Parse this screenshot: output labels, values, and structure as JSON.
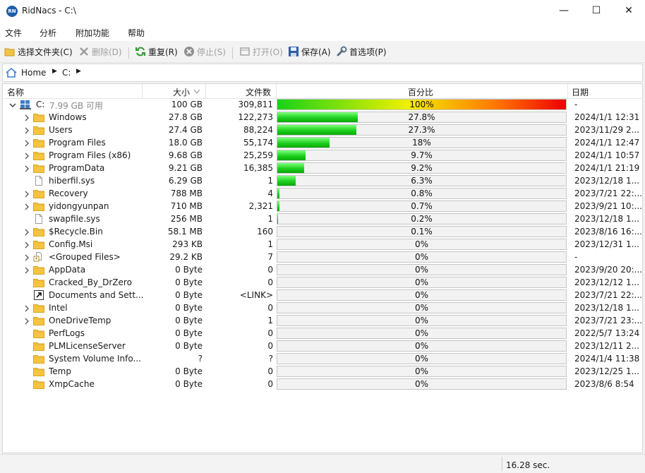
{
  "window": {
    "app_icon_text": "RN",
    "title": "RidNacs - C:\\",
    "minimize": "—",
    "maximize": "☐",
    "close": "✕"
  },
  "menu": [
    "文件",
    "分析",
    "附加功能",
    "帮助"
  ],
  "toolbar": {
    "select_folder": "选择文件夹(C)",
    "delete": "删除(D)",
    "rescan": "重复(R)",
    "stop": "停止(S)",
    "open": "打开(O)",
    "save": "保存(A)",
    "options": "首选项(P)"
  },
  "address": {
    "home": "Home",
    "drive": "C:"
  },
  "columns": {
    "name": "名称",
    "size": "大小",
    "files": "文件数",
    "percent": "百分比",
    "date": "日期"
  },
  "root": {
    "name": "C:",
    "free": "7.99 GB 可用",
    "size": "100 GB",
    "files": "309,811",
    "percent": 100,
    "percent_label": "100%",
    "date": "-"
  },
  "rows": [
    {
      "name": "Windows",
      "kind": "folder",
      "size": "27.8 GB",
      "files": "122,273",
      "percent": 27.8,
      "percent_label": "27.8%",
      "date": "2024/1/1 12:31",
      "expandable": true
    },
    {
      "name": "Users",
      "kind": "folder",
      "size": "27.4 GB",
      "files": "88,224",
      "percent": 27.3,
      "percent_label": "27.3%",
      "date": "2023/11/29 2...",
      "expandable": true
    },
    {
      "name": "Program Files",
      "kind": "folder",
      "size": "18.0 GB",
      "files": "55,174",
      "percent": 18,
      "percent_label": "18%",
      "date": "2024/1/1 12:47",
      "expandable": true
    },
    {
      "name": "Program Files (x86)",
      "kind": "folder",
      "size": "9.68 GB",
      "files": "25,259",
      "percent": 9.7,
      "percent_label": "9.7%",
      "date": "2024/1/1 10:57",
      "expandable": true
    },
    {
      "name": "ProgramData",
      "kind": "folder",
      "size": "9.21 GB",
      "files": "16,385",
      "percent": 9.2,
      "percent_label": "9.2%",
      "date": "2024/1/1 21:19",
      "expandable": true
    },
    {
      "name": "hiberfil.sys",
      "kind": "file",
      "size": "6.29 GB",
      "files": "1",
      "percent": 6.3,
      "percent_label": "6.3%",
      "date": "2023/12/18 1...",
      "expandable": false
    },
    {
      "name": "Recovery",
      "kind": "folder",
      "size": "788 MB",
      "files": "4",
      "percent": 0.8,
      "percent_label": "0.8%",
      "date": "2023/7/21 22:...",
      "expandable": true
    },
    {
      "name": "yidongyunpan",
      "kind": "folder",
      "size": "710 MB",
      "files": "2,321",
      "percent": 0.7,
      "percent_label": "0.7%",
      "date": "2023/9/21 10:...",
      "expandable": true
    },
    {
      "name": "swapfile.sys",
      "kind": "file",
      "size": "256 MB",
      "files": "1",
      "percent": 0.2,
      "percent_label": "0.2%",
      "date": "2023/12/18 1...",
      "expandable": false
    },
    {
      "name": "$Recycle.Bin",
      "kind": "folder",
      "size": "58.1 MB",
      "files": "160",
      "percent": 0.1,
      "percent_label": "0.1%",
      "date": "2023/8/16 16:...",
      "expandable": true
    },
    {
      "name": "Config.Msi",
      "kind": "folder",
      "size": "293 KB",
      "files": "1",
      "percent": 0,
      "percent_label": "0%",
      "date": "2023/12/31 1...",
      "expandable": true
    },
    {
      "name": "<Grouped Files>",
      "kind": "grouped",
      "size": "29.2 KB",
      "files": "7",
      "percent": 0,
      "percent_label": "0%",
      "date": "-",
      "expandable": true
    },
    {
      "name": "AppData",
      "kind": "folder",
      "size": "0 Byte",
      "files": "0",
      "percent": 0,
      "percent_label": "0%",
      "date": "2023/9/20 20:...",
      "expandable": true
    },
    {
      "name": "Cracked_By_DrZero",
      "kind": "folder",
      "size": "0 Byte",
      "files": "0",
      "percent": 0,
      "percent_label": "0%",
      "date": "2023/12/12 1...",
      "expandable": false
    },
    {
      "name": "Documents and Sett...",
      "kind": "link",
      "size": "0 Byte",
      "files": "<LINK>",
      "percent": 0,
      "percent_label": "0%",
      "date": "2023/7/21 22:...",
      "expandable": false
    },
    {
      "name": "Intel",
      "kind": "folder",
      "size": "0 Byte",
      "files": "0",
      "percent": 0,
      "percent_label": "0%",
      "date": "2023/12/18 1...",
      "expandable": true
    },
    {
      "name": "OneDriveTemp",
      "kind": "folder",
      "size": "0 Byte",
      "files": "1",
      "percent": 0,
      "percent_label": "0%",
      "date": "2023/7/21 23:...",
      "expandable": true
    },
    {
      "name": "PerfLogs",
      "kind": "folder",
      "size": "0 Byte",
      "files": "0",
      "percent": 0,
      "percent_label": "0%",
      "date": "2022/5/7 13:24",
      "expandable": false
    },
    {
      "name": "PLMLicenseServer",
      "kind": "folder",
      "size": "0 Byte",
      "files": "0",
      "percent": 0,
      "percent_label": "0%",
      "date": "2023/12/11 2...",
      "expandable": false
    },
    {
      "name": "System Volume Info...",
      "kind": "folder",
      "size": "?",
      "files": "?",
      "percent": 0,
      "percent_label": "0%",
      "date": "2024/1/4 11:38",
      "expandable": false
    },
    {
      "name": "Temp",
      "kind": "folder",
      "size": "0 Byte",
      "files": "0",
      "percent": 0,
      "percent_label": "0%",
      "date": "2023/12/25 1...",
      "expandable": false
    },
    {
      "name": "XmpCache",
      "kind": "folder",
      "size": "0 Byte",
      "files": "0",
      "percent": 0,
      "percent_label": "0%",
      "date": "2023/8/6 8:54",
      "expandable": false
    }
  ],
  "status": {
    "elapsed": "16.28 sec."
  },
  "colors": {
    "bar_green": "#1ed01e",
    "folder_yellow": "#f5c542",
    "accent": "#1f5fa8"
  }
}
